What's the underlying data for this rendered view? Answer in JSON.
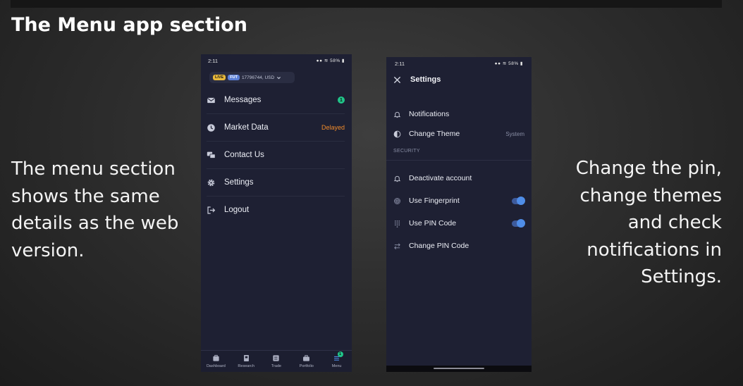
{
  "slide": {
    "title": "The Menu app section",
    "caption_left": "The menu section shows the same details as the web version.",
    "caption_right": "Change the pin, change themes and check notifications in Settings."
  },
  "phone_menu": {
    "status_time": "2:11",
    "status_battery": "58%",
    "account": {
      "live_label": "LIVE",
      "fut_label": "FUT",
      "account_text": "17796744, USD"
    },
    "menu_items": [
      {
        "label": "Messages",
        "icon": "mail-icon",
        "badge": "1"
      },
      {
        "label": "Market Data",
        "icon": "clock-icon",
        "value": "Delayed"
      },
      {
        "label": "Contact Us",
        "icon": "chat-icon"
      },
      {
        "label": "Settings",
        "icon": "gear-icon"
      },
      {
        "label": "Logout",
        "icon": "logout-icon"
      }
    ],
    "bottom_nav": [
      {
        "label": "Dashboard",
        "icon": "dashboard-icon"
      },
      {
        "label": "Research",
        "icon": "research-icon"
      },
      {
        "label": "Trade",
        "icon": "trade-icon"
      },
      {
        "label": "Portfolio",
        "icon": "portfolio-icon"
      },
      {
        "label": "Menu",
        "icon": "menu-icon",
        "badge": "1"
      }
    ]
  },
  "phone_settings": {
    "status_time": "2:11",
    "status_battery": "58%",
    "header_title": "Settings",
    "rows": [
      {
        "label": "Notifications",
        "icon": "bell-icon"
      },
      {
        "label": "Change Theme",
        "icon": "theme-icon",
        "value": "System"
      }
    ],
    "section_security": "SECURITY",
    "security_rows": [
      {
        "label": "Deactivate account",
        "icon": "bell-icon"
      },
      {
        "label": "Use Fingerprint",
        "icon": "fingerprint-icon",
        "toggle_on": true
      },
      {
        "label": "Use PIN Code",
        "icon": "keypad-icon",
        "toggle_on": true
      },
      {
        "label": "Change PIN Code",
        "icon": "swap-icon"
      }
    ]
  },
  "colors": {
    "phone_bg": "#1e2033",
    "badge_green": "#21c58a",
    "delayed_orange": "#f08a2b",
    "toggle_blue": "#4f8de8",
    "live_yellow": "#e8b83a",
    "fut_blue": "#5b7fd6"
  }
}
